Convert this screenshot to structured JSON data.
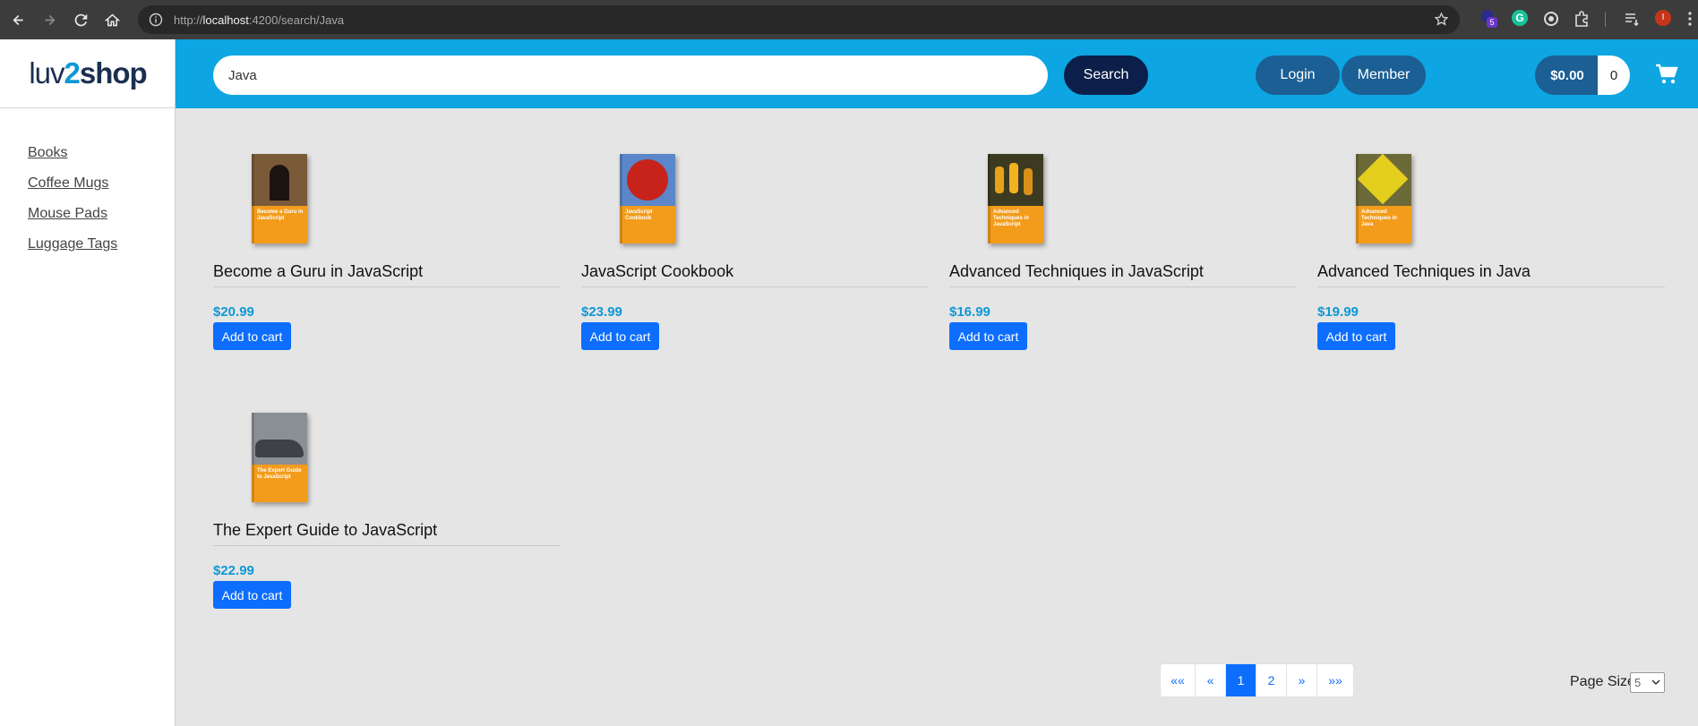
{
  "browser": {
    "url_prefix": "http://",
    "url_host": "localhost",
    "url_rest": ":4200/search/Java",
    "ext_badge": "5",
    "profile_initial": "I"
  },
  "app": {
    "logo_left": "luv",
    "logo_mid": "2",
    "logo_right": "shop",
    "search": {
      "value": "Java",
      "button": "Search"
    },
    "login_label": "Login",
    "member_label": "Member",
    "cart_total": "$0.00",
    "cart_count": "0"
  },
  "sidebar": {
    "items": [
      {
        "label": "Books"
      },
      {
        "label": "Coffee Mugs"
      },
      {
        "label": "Mouse Pads"
      },
      {
        "label": "Luggage Tags"
      }
    ]
  },
  "products": [
    {
      "title": "Become a Guru in JavaScript",
      "cover_text": "Become a Guru in JavaScript",
      "price": "$20.99",
      "button": "Add to cart",
      "cover_color": "#7b5a3a"
    },
    {
      "title": "JavaScript Cookbook",
      "cover_text": "JavaScript Cookbook",
      "price": "$23.99",
      "button": "Add to cart",
      "cover_color": "#c7231a"
    },
    {
      "title": "Advanced Techniques in JavaScript",
      "cover_text": "Advanced Techniques in JavaScript",
      "price": "$16.99",
      "button": "Add to cart",
      "cover_color": "#d08a16"
    },
    {
      "title": "Advanced Techniques in Java",
      "cover_text": "Advanced Techniques in Java",
      "price": "$19.99",
      "button": "Add to cart",
      "cover_color": "#c9b21b"
    },
    {
      "title": "The Expert Guide to JavaScript",
      "cover_text": "The Expert Guide to JavaScript",
      "price": "$22.99",
      "button": "Add to cart",
      "cover_color": "#8a8f94"
    }
  ],
  "pagination": {
    "first": "««",
    "prev": "«",
    "pages": [
      "1",
      "2"
    ],
    "next": "»",
    "last": "»»",
    "current": "1"
  },
  "page_size": {
    "label": "Page Size",
    "value": "5"
  },
  "colors": {
    "accent": "#0da5e2",
    "primary_button": "#0d6efd",
    "price": "#0d98d6"
  }
}
